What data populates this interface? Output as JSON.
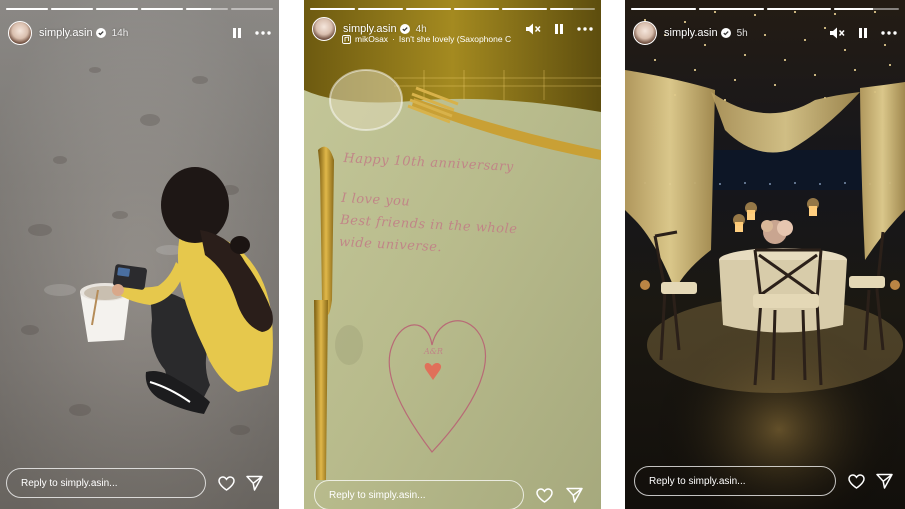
{
  "stories": [
    {
      "username": "simply.asin",
      "time": "14h",
      "progress": [
        1,
        1,
        1,
        1,
        0.6,
        0
      ],
      "reply_placeholder": "Reply to simply.asin...",
      "muted": false,
      "music": null
    },
    {
      "username": "simply.asin",
      "time": "4h",
      "progress": [
        1,
        1,
        1,
        1,
        1,
        0.5
      ],
      "reply_placeholder": "Reply to simply.asin...",
      "muted": true,
      "music": {
        "artist": "mikOsax",
        "track": "Isn't she lovely (Saxophone C"
      }
    },
    {
      "username": "simply.asin",
      "time": "5h",
      "progress": [
        1,
        1,
        1,
        0.6
      ],
      "reply_placeholder": "Reply to simply.asin...",
      "muted": true,
      "music": null
    }
  ],
  "note_text": {
    "line1": "Happy 10th anniversary",
    "line2": "I love you",
    "line3": "Best friends in the whole",
    "line4": "wide universe.",
    "heart_label": "A&R"
  },
  "icons": {
    "verified": "verified-badge-icon",
    "pause": "pause-icon",
    "more": "more-dots-icon",
    "mute": "speaker-muted-icon",
    "heart": "heart-icon",
    "send": "send-icon",
    "music": "music-note-icon"
  },
  "colors": {
    "verified_blue": "#3897f0",
    "text": "#ffffff"
  }
}
